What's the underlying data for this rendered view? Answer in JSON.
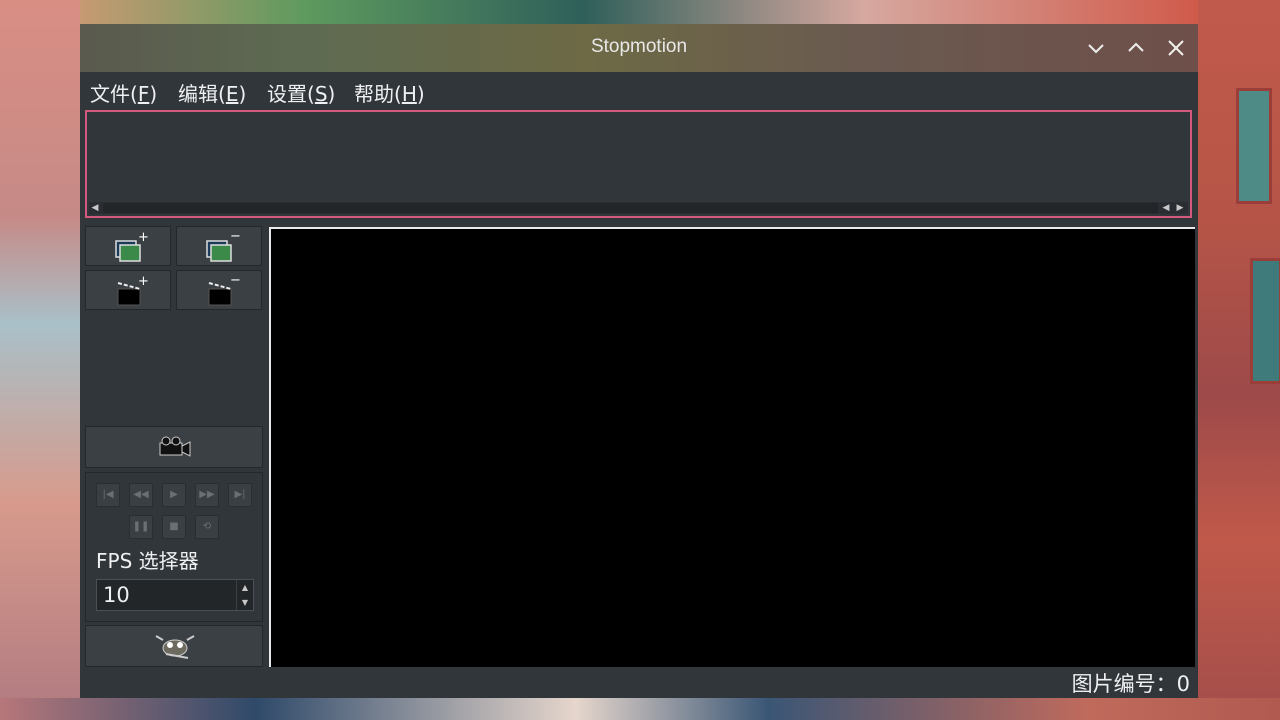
{
  "window": {
    "title": "Stopmotion",
    "controls": [
      "minimize-icon",
      "maximize-icon",
      "close-icon"
    ]
  },
  "menu": {
    "file": {
      "label": "文件(",
      "key": "F",
      "end": ")"
    },
    "edit": {
      "label": "编辑(",
      "key": "E",
      "end": ")"
    },
    "settings": {
      "label": "设置(",
      "key": "S",
      "end": ")"
    },
    "help": {
      "label": "帮助(",
      "key": "H",
      "end": ")"
    }
  },
  "sidebar": {
    "add_frames_icon": "add-frames-icon",
    "remove_frames_icon": "remove-frames-icon",
    "add_scene_icon": "add-scene-icon",
    "remove_scene_icon": "remove-scene-icon",
    "camera_icon": "camera-icon",
    "gimp_icon": "gimp-icon",
    "fps_label": "FPS 选择器",
    "fps_value": "10"
  },
  "playback": {
    "buttons_row1": [
      "first-frame-icon",
      "previous-frame-icon",
      "play-icon",
      "next-frame-icon",
      "last-frame-icon"
    ],
    "buttons_row2": [
      "pause-icon",
      "stop-icon",
      "loop-icon"
    ]
  },
  "status": {
    "text": "图片编号：0"
  },
  "colors": {
    "window_bg": "#31363b",
    "frames_border": "#d45a7d",
    "preview_bg": "#000000"
  }
}
